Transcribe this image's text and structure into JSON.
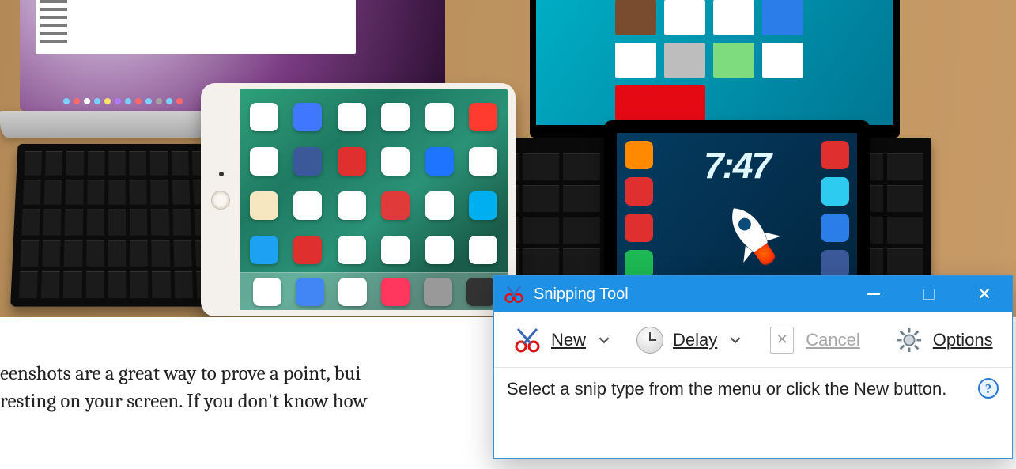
{
  "hero": {
    "android_clock": "7:47"
  },
  "article": {
    "line1": "eenshots are a great way to prove a point, bui",
    "line2": "resting on your screen. If you don't know how"
  },
  "snip": {
    "title": "Snipping Tool",
    "new_label": "New",
    "delay_label": "Delay",
    "cancel_label": "Cancel",
    "options_label": "Options",
    "status": "Select a snip type from the menu or click the New button."
  }
}
